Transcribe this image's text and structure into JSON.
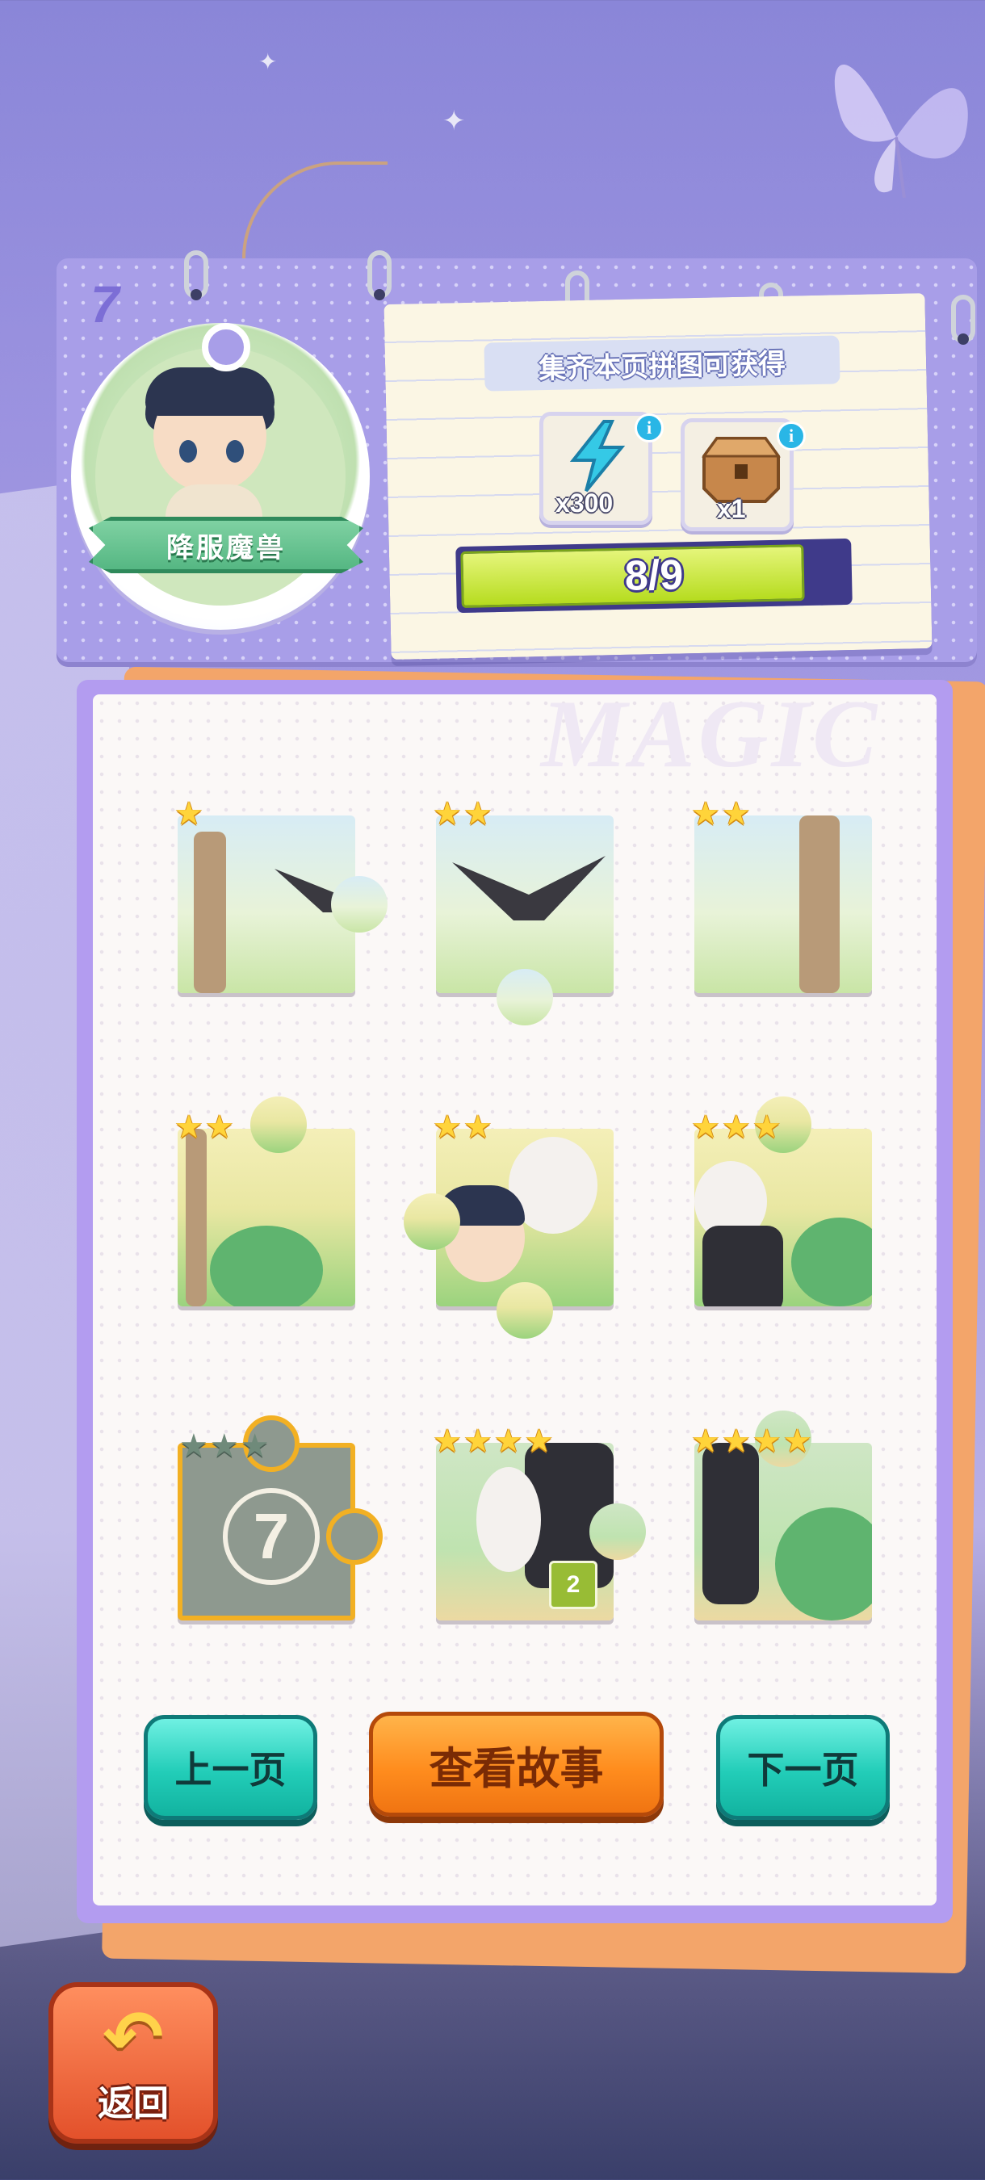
{
  "page": {
    "number": "7",
    "chapter_title": "降服魔兽"
  },
  "reward": {
    "title": "集齐本页拼图可获得",
    "items": [
      {
        "icon": "energy-bolt-icon",
        "quantity": "x300"
      },
      {
        "icon": "wooden-chest-icon",
        "quantity": "x1"
      }
    ],
    "progress_text": "8/9",
    "progress_fraction": 0.889
  },
  "board": {
    "watermark": "MAGIC"
  },
  "pieces": [
    {
      "stars": 1,
      "max_stars": 1,
      "locked": false
    },
    {
      "stars": 2,
      "max_stars": 2,
      "locked": false
    },
    {
      "stars": 2,
      "max_stars": 2,
      "locked": false
    },
    {
      "stars": 2,
      "max_stars": 2,
      "locked": false
    },
    {
      "stars": 2,
      "max_stars": 2,
      "locked": false
    },
    {
      "stars": 3,
      "max_stars": 3,
      "locked": false
    },
    {
      "stars": 0,
      "max_stars": 3,
      "locked": true,
      "lock_number": "7"
    },
    {
      "stars": 4,
      "max_stars": 4,
      "locked": false,
      "badge": "2"
    },
    {
      "stars": 4,
      "max_stars": 4,
      "locked": false
    }
  ],
  "buttons": {
    "prev": "上一页",
    "story": "查看故事",
    "next": "下一页",
    "back": "返回"
  },
  "colors": {
    "accent_teal": "#22cdb8",
    "accent_orange": "#ff8d1e",
    "progress_green": "#b6dc1f",
    "board_frame": "#b39cf0"
  }
}
